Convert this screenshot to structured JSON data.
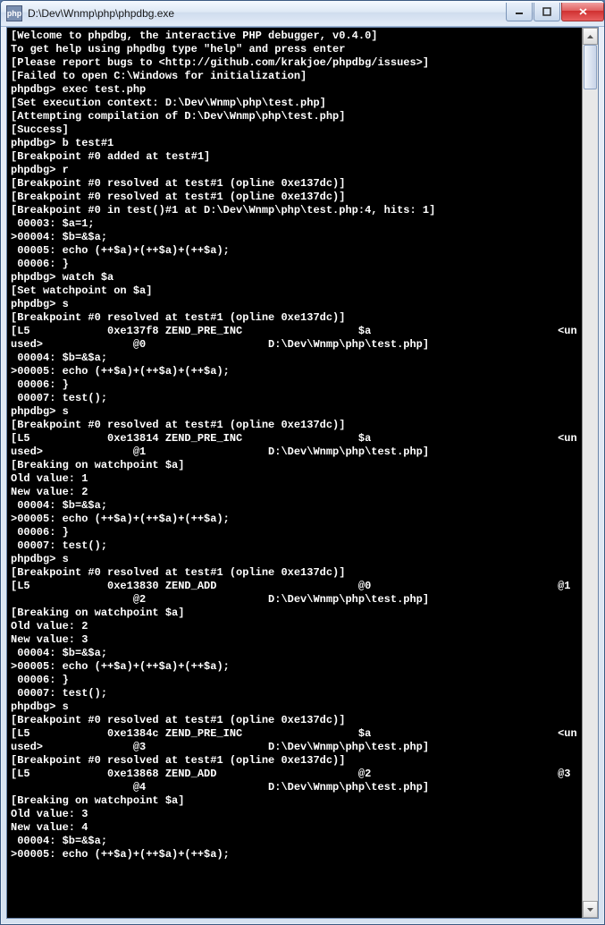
{
  "window": {
    "icon_label": "php",
    "title": "D:\\Dev\\Wnmp\\php\\phpdbg.exe"
  },
  "console_lines": [
    "[Welcome to phpdbg, the interactive PHP debugger, v0.4.0]",
    "To get help using phpdbg type \"help\" and press enter",
    "[Please report bugs to <http://github.com/krakjoe/phpdbg/issues>]",
    "[Failed to open C:\\Windows for initialization]",
    "phpdbg> exec test.php",
    "[Set execution context: D:\\Dev\\Wnmp\\php\\test.php]",
    "[Attempting compilation of D:\\Dev\\Wnmp\\php\\test.php]",
    "[Success]",
    "phpdbg> b test#1",
    "[Breakpoint #0 added at test#1]",
    "phpdbg> r",
    "[Breakpoint #0 resolved at test#1 (opline 0xe137dc)]",
    "[Breakpoint #0 resolved at test#1 (opline 0xe137dc)]",
    "[Breakpoint #0 in test()#1 at D:\\Dev\\Wnmp\\php\\test.php:4, hits: 1]",
    " 00003: $a=1;",
    ">00004: $b=&$a;",
    " 00005: echo (++$a)+(++$a)+(++$a);",
    " 00006: }",
    "phpdbg> watch $a",
    "[Set watchpoint on $a]",
    "phpdbg> s",
    "[Breakpoint #0 resolved at test#1 (opline 0xe137dc)]",
    "[L5            0xe137f8 ZEND_PRE_INC                  $a                             <un",
    "used>              @0                   D:\\Dev\\Wnmp\\php\\test.php]",
    " 00004: $b=&$a;",
    ">00005: echo (++$a)+(++$a)+(++$a);",
    " 00006: }",
    " 00007: test();",
    "phpdbg> s",
    "[Breakpoint #0 resolved at test#1 (opline 0xe137dc)]",
    "[L5            0xe13814 ZEND_PRE_INC                  $a                             <un",
    "used>              @1                   D:\\Dev\\Wnmp\\php\\test.php]",
    "[Breaking on watchpoint $a]",
    "Old value: 1",
    "New value: 2",
    " 00004: $b=&$a;",
    ">00005: echo (++$a)+(++$a)+(++$a);",
    " 00006: }",
    " 00007: test();",
    "phpdbg> s",
    "[Breakpoint #0 resolved at test#1 (opline 0xe137dc)]",
    "[L5            0xe13830 ZEND_ADD                      @0                             @1",
    "                   @2                   D:\\Dev\\Wnmp\\php\\test.php]",
    "[Breaking on watchpoint $a]",
    "Old value: 2",
    "New value: 3",
    " 00004: $b=&$a;",
    ">00005: echo (++$a)+(++$a)+(++$a);",
    " 00006: }",
    " 00007: test();",
    "phpdbg> s",
    "[Breakpoint #0 resolved at test#1 (opline 0xe137dc)]",
    "[L5            0xe1384c ZEND_PRE_INC                  $a                             <un",
    "used>              @3                   D:\\Dev\\Wnmp\\php\\test.php]",
    "[Breakpoint #0 resolved at test#1 (opline 0xe137dc)]",
    "[L5            0xe13868 ZEND_ADD                      @2                             @3",
    "                   @4                   D:\\Dev\\Wnmp\\php\\test.php]",
    "[Breaking on watchpoint $a]",
    "Old value: 3",
    "New value: 4",
    " 00004: $b=&$a;",
    ">00005: echo (++$a)+(++$a)+(++$a);"
  ]
}
